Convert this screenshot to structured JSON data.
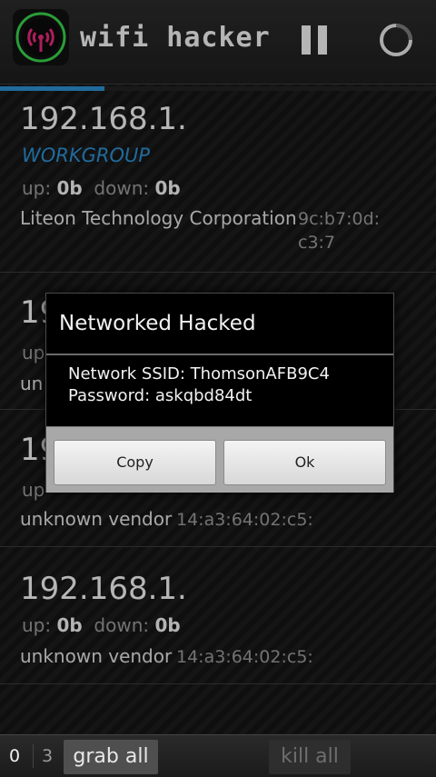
{
  "app": {
    "title": "wifi hacker",
    "accent": "#2b8fd0",
    "icon": "wifi-hotspot-icon"
  },
  "toolbar": {
    "pause_icon": "pause-icon",
    "refresh_icon": "refresh-icon"
  },
  "scan_progress": 0.24,
  "hosts": [
    {
      "ip": "192.168.1.",
      "workgroup": "WORKGROUP",
      "up_label": "up:",
      "up_value": "0b",
      "down_label": "down:",
      "down_value": "0b",
      "vendor": "Liteon Technology Corporation",
      "mac_line1": "9c:b7:0d:",
      "mac_line2": "c3:7"
    },
    {
      "ip": "19",
      "up_label": "up",
      "vendor": "un"
    },
    {
      "ip": "19",
      "up_label": "up",
      "vendor": "unknown vendor",
      "mac": "14:a3:64:02:c5:"
    },
    {
      "ip": "192.168.1.",
      "up_label": "up:",
      "up_value": "0b",
      "down_label": "down:",
      "down_value": "0b",
      "vendor": "unknown vendor",
      "mac": "14:a3:64:02:c5:"
    }
  ],
  "dialog": {
    "title": "Networked Hacked",
    "ssid_line": "Network SSID: ThomsonAFB9C4",
    "password_line": "Password: askqbd84dt",
    "copy_label": "Copy",
    "ok_label": "Ok"
  },
  "bottom": {
    "count_a": "0",
    "count_b": "3",
    "grab_all_label": "grab all",
    "kill_all_label": "kill all"
  }
}
